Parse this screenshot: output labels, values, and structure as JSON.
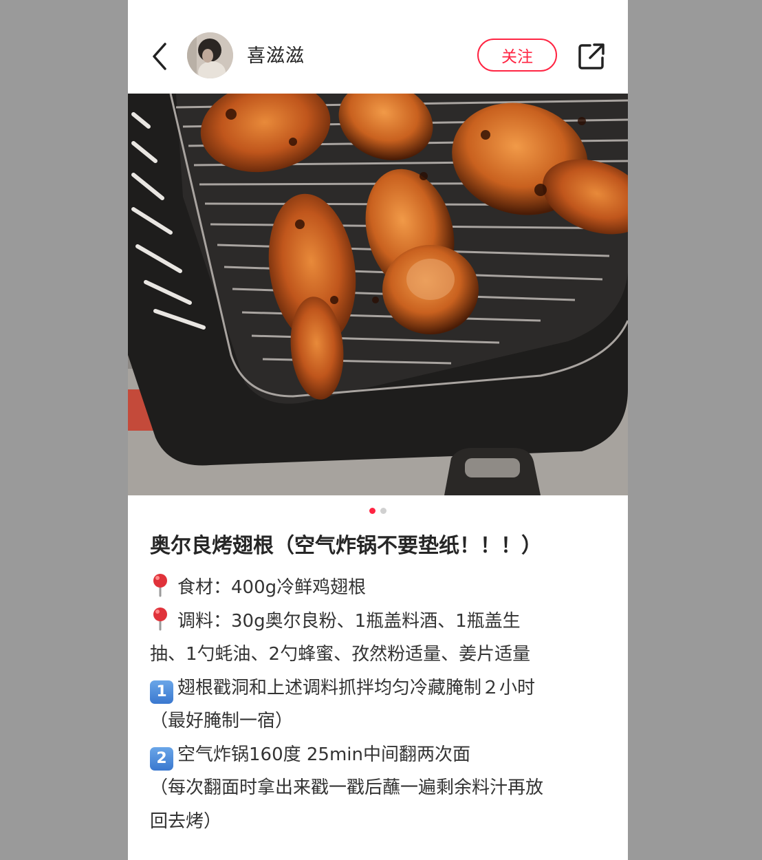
{
  "header": {
    "username": "喜滋滋",
    "follow_label": "关注"
  },
  "carousel": {
    "total": 2,
    "active_index": 0
  },
  "note": {
    "title": "奥尔良烤翅根（空气炸锅不要垫纸！！！）",
    "lines": [
      "食材：400g冷鲜鸡翅根",
      "调料：30g奥尔良粉、1瓶盖料酒、1瓶盖生",
      "抽、1勺蚝油、2勺蜂蜜、孜然粉适量、姜片适量",
      "翅根戳洞和上述调料抓拌均匀冷藏腌制２小时",
      "（最好腌制一宿）",
      "空气炸锅160度 25min中间翻两次面",
      "（每次翻面时拿出来戳一戳后蘸一遍剩余料汁再放",
      "回去烤）"
    ],
    "step1_number": "1",
    "step2_number": "2"
  },
  "colors": {
    "accent": "#ff2442",
    "text": "#333333",
    "background": "#9a9a9a"
  }
}
